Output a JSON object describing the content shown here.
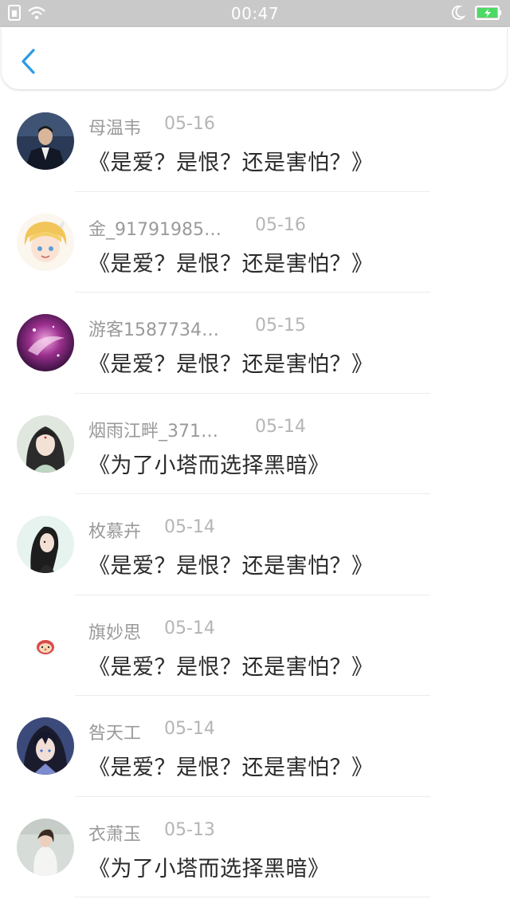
{
  "status_bar": {
    "time": "00:47",
    "icons": [
      "sim-icon",
      "wifi-icon",
      "moon-icon",
      "battery-charging-icon"
    ],
    "battery_color": "#4cd964"
  },
  "nav": {
    "back_icon": "chevron-left-icon",
    "accent_color": "#2b9be5"
  },
  "items": [
    {
      "username": "母温韦",
      "date": "05-16",
      "message": "《是爱？是恨？还是害怕？》",
      "avatar": "avatar-photo-man-suit"
    },
    {
      "username": "金_91791985…",
      "date": "05-16",
      "message": "《是爱？是恨？还是害怕？》",
      "avatar": "avatar-anime-blonde-girl"
    },
    {
      "username": "游客1587734…",
      "date": "05-15",
      "message": "《是爱？是恨？还是害怕？》",
      "avatar": "avatar-purple-fantasy"
    },
    {
      "username": "烟雨江畔_371…",
      "date": "05-14",
      "message": "《为了小塔而选择黑暗》",
      "avatar": "avatar-ancient-style-girl"
    },
    {
      "username": "枚慕卉",
      "date": "05-14",
      "message": "《是爱？是恨？还是害怕？》",
      "avatar": "avatar-sketch-girl"
    },
    {
      "username": "旗妙思",
      "date": "05-14",
      "message": "《是爱？是恨？还是害怕？》",
      "avatar": "avatar-small-cartoon-face"
    },
    {
      "username": "咎天工",
      "date": "05-14",
      "message": "《是爱？是恨？还是害怕？》",
      "avatar": "avatar-anime-dark-hair-boy"
    },
    {
      "username": "衣萧玉",
      "date": "05-13",
      "message": "《为了小塔而选择黑暗》",
      "avatar": "avatar-photo-woman-white"
    }
  ]
}
